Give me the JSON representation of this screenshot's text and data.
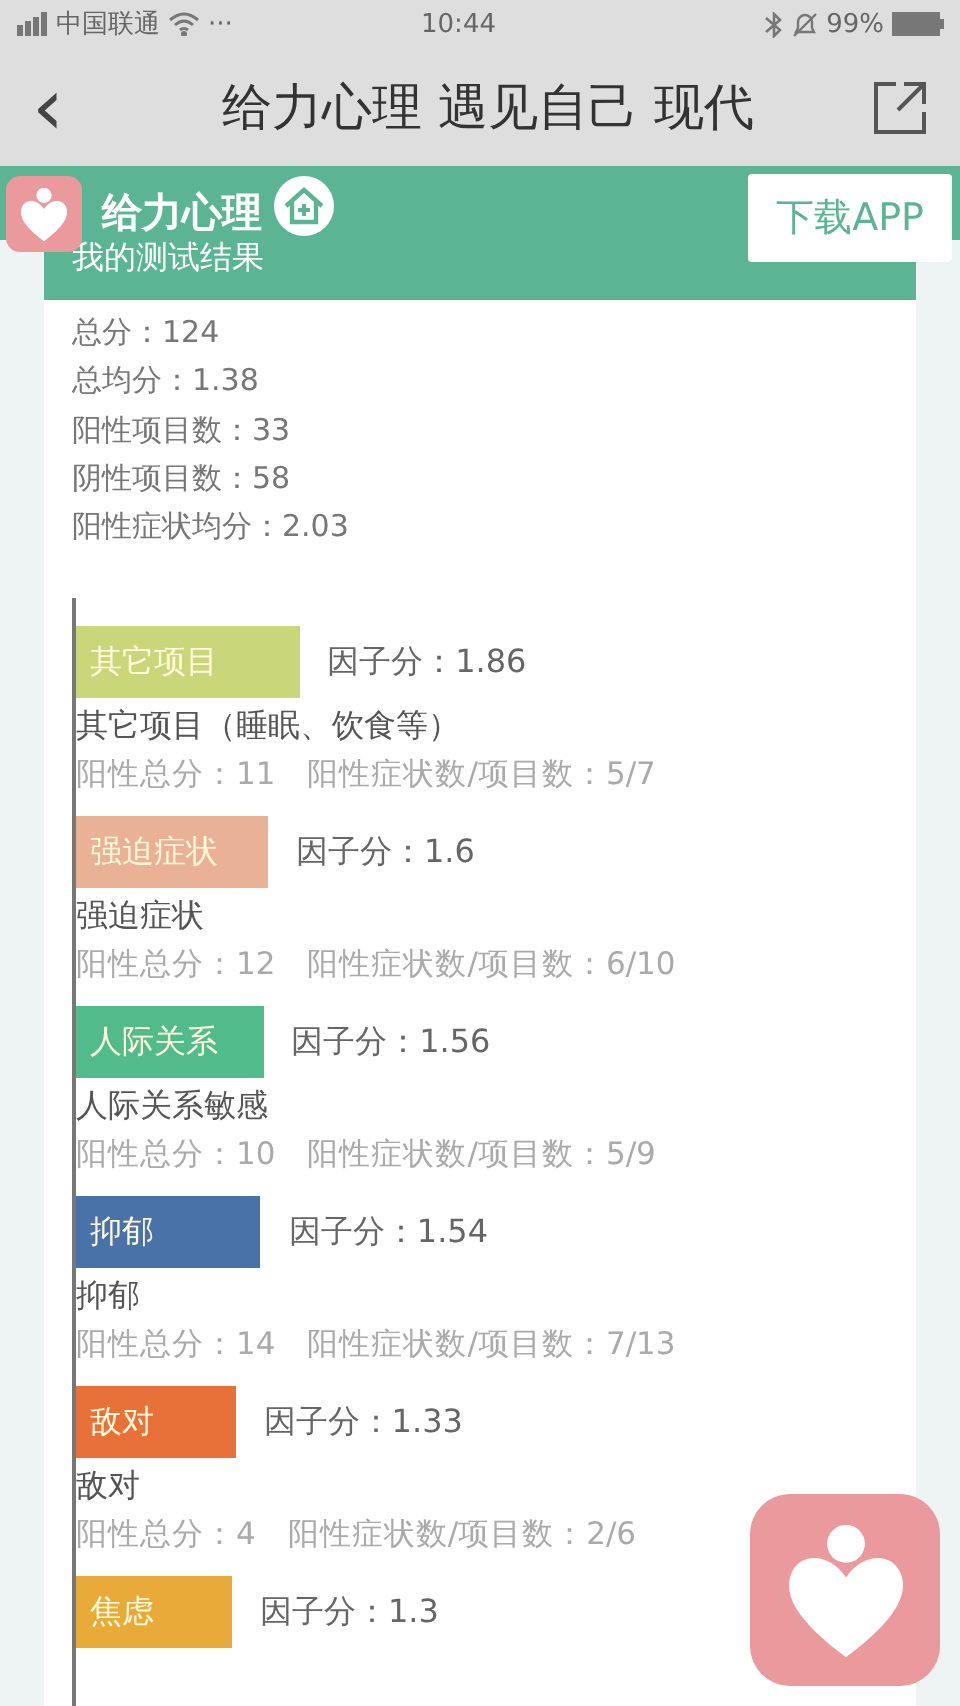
{
  "status_bar": {
    "carrier": "中国联通",
    "dots": "···",
    "time": "10:44",
    "battery": "99%"
  },
  "nav": {
    "back": "‹",
    "title": "给力心理 遇见自己 现代"
  },
  "banner": {
    "brand": "给力心理",
    "download": "下载APP"
  },
  "card": {
    "header": "我的测试结果",
    "summary": [
      "总分：124",
      "总均分：1.38",
      "阳性项目数：33",
      "阴性项目数：58",
      "阳性症状均分：2.03"
    ],
    "factors": [
      {
        "label": "其它项目",
        "color": "#c9d67a",
        "score": "因子分：1.86",
        "name": "其它项目（睡眠、饮食等）",
        "stats": [
          "阳性总分：11",
          "阳性症状数/项目数：5/7"
        ]
      },
      {
        "label": "强迫症状",
        "color": "#e9b196",
        "score": "因子分：1.6",
        "name": "强迫症状",
        "stats": [
          "阳性总分：12",
          "阳性症状数/项目数：6/10"
        ]
      },
      {
        "label": "人际关系",
        "color": "#52bb8c",
        "score": "因子分：1.56",
        "name": "人际关系敏感",
        "stats": [
          "阳性总分：10",
          "阳性症状数/项目数：5/9"
        ]
      },
      {
        "label": "抑郁",
        "color": "#4872a8",
        "score": "因子分：1.54",
        "name": "抑郁",
        "stats": [
          "阳性总分：14",
          "阳性症状数/项目数：7/13"
        ]
      },
      {
        "label": "敌对",
        "color": "#e8713a",
        "score": "因子分：1.33",
        "name": "敌对",
        "stats": [
          "阳性总分：4",
          "阳性症状数/项目数：2/6"
        ]
      },
      {
        "label": "焦虑",
        "color": "#e8aa38",
        "score": "因子分：1.3"
      }
    ]
  }
}
